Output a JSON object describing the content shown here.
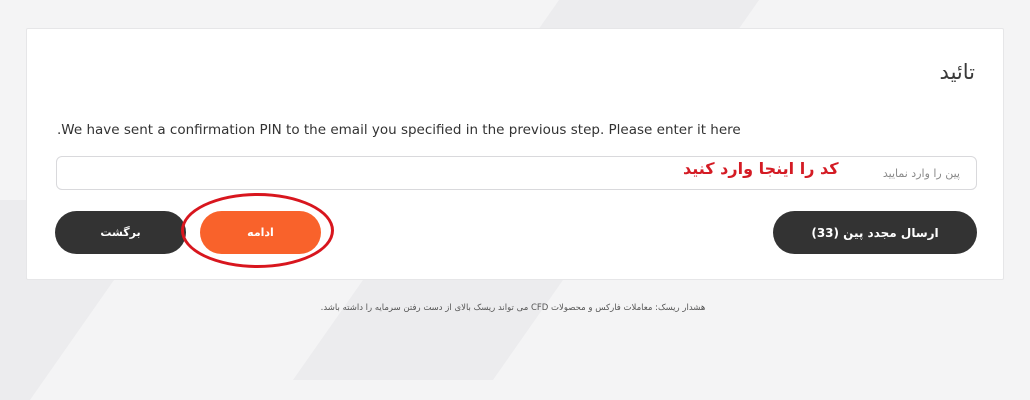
{
  "page": {
    "title": "تائید",
    "info_text": ".We have sent a confirmation PIN to the email you specified in the previous step. Please enter it here",
    "pin_input": {
      "value": "",
      "placeholder": "پین را وارد نمایید"
    },
    "annotation_text": "کد را اینجا وارد کنید",
    "buttons": {
      "back_label": "برگشت",
      "continue_label": "ادامه",
      "resend_label": "ارسال مجدد پین (33)"
    },
    "footer_text": "هشدار ریسک: معاملات فارکس و محصولات CFD می تواند ریسک بالای از دست رفتن سرمایه را داشته باشد."
  },
  "colors": {
    "accent": "#f9622b",
    "dark_button": "#333333",
    "annotation_red": "#d41b24"
  }
}
